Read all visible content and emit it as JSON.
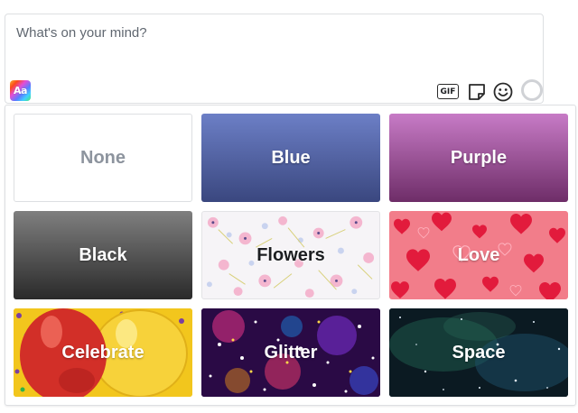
{
  "composer": {
    "placeholder": "What's on your mind?",
    "aa_label": "Aa",
    "gif_label": "GIF"
  },
  "backgrounds": [
    {
      "label": "None"
    },
    {
      "label": "Blue"
    },
    {
      "label": "Purple"
    },
    {
      "label": "Black"
    },
    {
      "label": "Flowers"
    },
    {
      "label": "Love"
    },
    {
      "label": "Celebrate"
    },
    {
      "label": "Glitter"
    },
    {
      "label": "Space"
    }
  ],
  "icons": [
    "aa-icon",
    "gif-icon",
    "sticker-icon",
    "emoji-icon"
  ],
  "colors": {
    "blue_top": "#6c7fc6",
    "blue_bottom": "#3a477f",
    "purple_top": "#c77bc6",
    "purple_bottom": "#6e2d68",
    "black_top": "#7f7f7f",
    "black_bottom": "#2a2a2a",
    "border": "#dddfe2"
  }
}
